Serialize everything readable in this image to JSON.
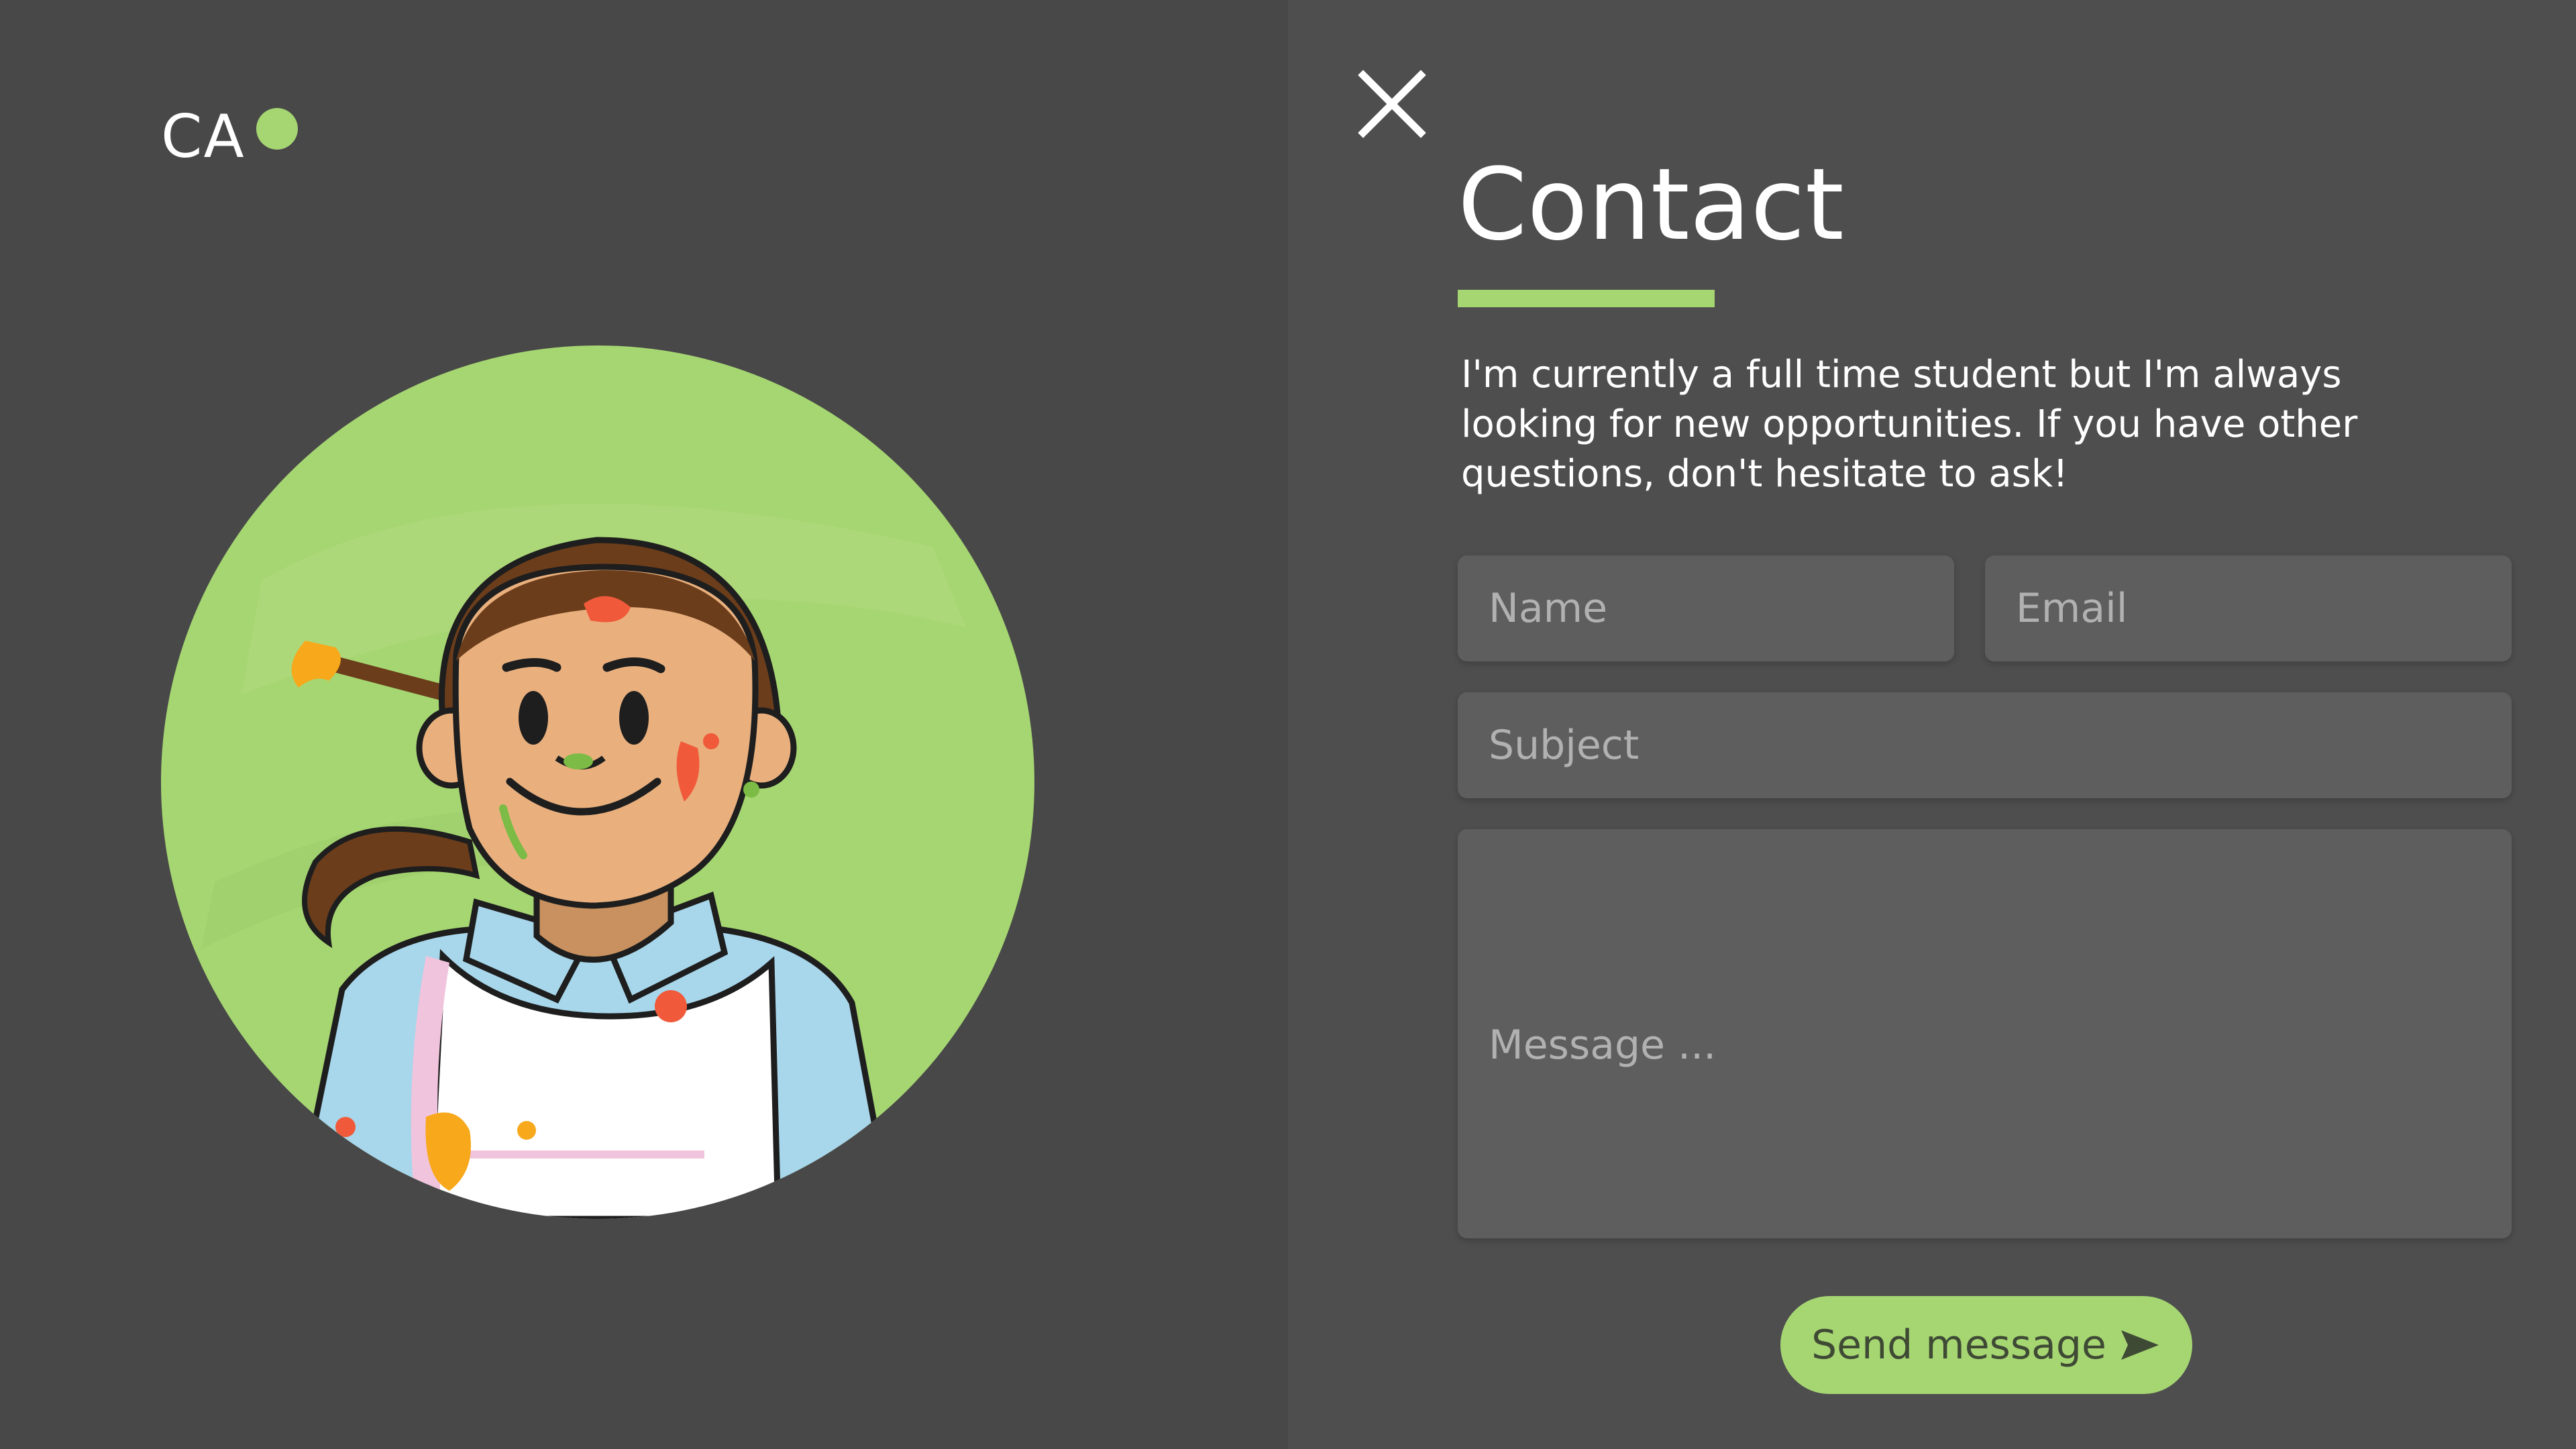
{
  "brand": {
    "text": "CA"
  },
  "colors": {
    "accent": "#a6d672",
    "panel_left": "#484848",
    "panel_right": "#4e4e4e",
    "field_bg": "#5e5e5e"
  },
  "icons": {
    "close": "close-icon",
    "send": "send-arrow-icon"
  },
  "contact": {
    "title": "Contact",
    "intro": "I'm currently a full time student but I'm always looking for new opportunities. If you have other questions, don't hesitate to ask!"
  },
  "form": {
    "name_placeholder": "Name",
    "email_placeholder": "Email",
    "subject_placeholder": "Subject",
    "message_placeholder": "Message ...",
    "send_label": "Send message"
  }
}
